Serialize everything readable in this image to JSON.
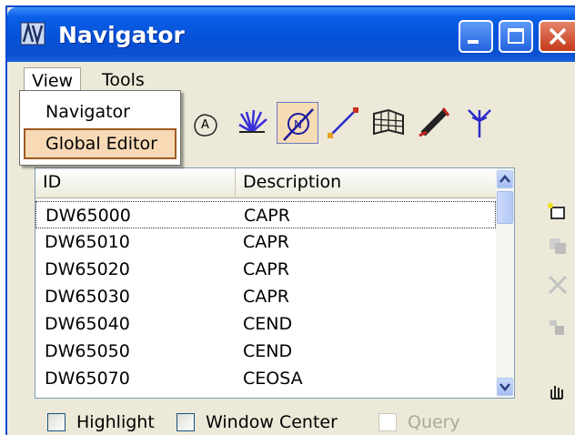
{
  "window": {
    "title": "Navigator"
  },
  "menubar": {
    "view": "View",
    "tools": "Tools"
  },
  "view_menu": {
    "items": [
      "Navigator",
      "Global Editor"
    ],
    "selected": "Global Editor"
  },
  "list": {
    "headers": {
      "id": "ID",
      "description": "Description"
    },
    "rows": [
      {
        "id": "DW65000",
        "description": "CAPR"
      },
      {
        "id": "DW65010",
        "description": "CAPR"
      },
      {
        "id": "DW65020",
        "description": "CAPR"
      },
      {
        "id": "DW65030",
        "description": "CAPR"
      },
      {
        "id": "DW65040",
        "description": "CEND"
      },
      {
        "id": "DW65050",
        "description": "CEND"
      },
      {
        "id": "DW65070",
        "description": "CEOSA"
      }
    ]
  },
  "options": {
    "highlight": "Highlight",
    "window_center": "Window Center",
    "query": "Query"
  },
  "colors": {
    "titlebar": "#0552d8",
    "selected_menu_bg": "#f7d9b6",
    "active_tool_bg": "#f6dcb4"
  }
}
